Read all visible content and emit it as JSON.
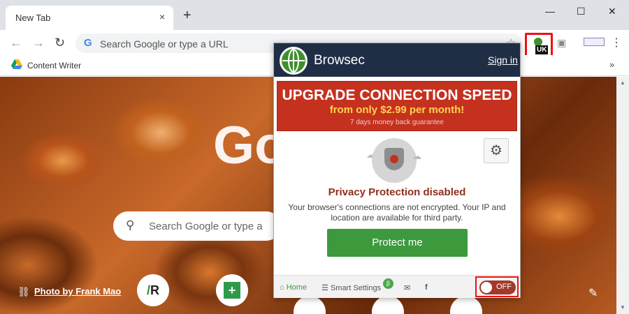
{
  "tab": {
    "title": "New Tab",
    "close_icon": "×"
  },
  "newtab_label": "+",
  "window": {
    "minimize": "—",
    "maximize": "☐",
    "close": "✕"
  },
  "toolbar": {
    "omnibox_placeholder": "Search Google or type a URL",
    "g_letter": "G"
  },
  "bookmarks": [
    {
      "label": "Content Writer"
    }
  ],
  "bookmarks_more": "»",
  "ext": {
    "uk_label": "UK"
  },
  "page": {
    "google_letters": "Go",
    "search_placeholder": "Search Google or type a",
    "photo_credit": "Photo by Frank Mao"
  },
  "popup": {
    "brand": "Browsec",
    "signin": "Sign in",
    "upgrade_title": "UPGRADE CONNECTION SPEED",
    "upgrade_price": "from only $2.99 per month!",
    "upgrade_note": "7 days money back guarantee",
    "status_title": "Privacy Protection disabled",
    "status_desc": "Your browser's connections are not encrypted. Your IP and location are available for third party.",
    "protect_button": "Protect me",
    "footer": {
      "home": "Home",
      "smart_settings": "Smart Settings",
      "beta": "β",
      "mail_icon": "✉",
      "facebook_icon": "f"
    },
    "toggle_label": "OFF"
  },
  "colors": {
    "accent_red": "#c5311f",
    "protect_green": "#3c9a3c",
    "header_navy": "#1f2e45"
  }
}
